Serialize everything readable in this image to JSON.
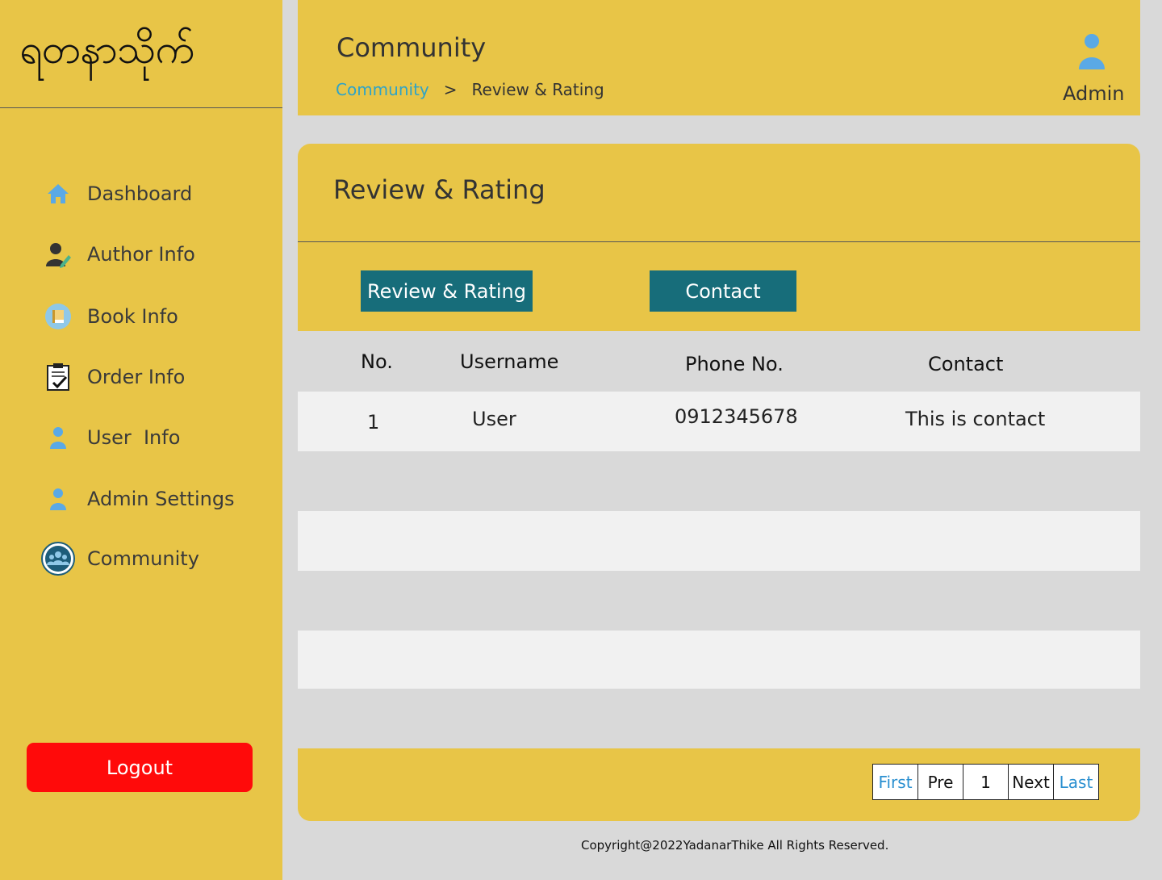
{
  "sidebar": {
    "logo": "ရတနာသိုက်",
    "items": [
      {
        "label": "Dashboard",
        "icon": "home-icon"
      },
      {
        "label": "Author Info",
        "icon": "author-icon"
      },
      {
        "label": "Book Info",
        "icon": "book-icon"
      },
      {
        "label": "Order Info",
        "icon": "clipboard-icon"
      },
      {
        "label": "User  Info",
        "icon": "user-icon"
      },
      {
        "label": "Admin Settings",
        "icon": "admin-icon"
      },
      {
        "label": "Community",
        "icon": "community-icon"
      }
    ],
    "logout_label": "Logout"
  },
  "header": {
    "title": "Community",
    "breadcrumb": {
      "parent": "Community",
      "separator": ">",
      "current": "Review & Rating"
    },
    "user_label": "Admin"
  },
  "card": {
    "title": "Review & Rating",
    "tabs": [
      "Review & Rating",
      "Contact"
    ]
  },
  "table": {
    "headers": {
      "no": "No.",
      "username": "Username",
      "phone": "Phone No.",
      "contact": "Contact"
    },
    "rows": [
      {
        "no": "1",
        "username": "User",
        "phone": "0912345678",
        "contact": "This is contact"
      }
    ]
  },
  "pagination": {
    "first": "First",
    "pre": "Pre",
    "current": "1",
    "next": "Next",
    "last": "Last"
  },
  "footer": {
    "copyright": "Copyright@2022YadanarThike All Rights Reserved."
  },
  "colors": {
    "panel": "#e8c547",
    "tab_button": "#176d7a",
    "logout": "#ff0a0a",
    "link": "#2ea3c7",
    "icon_blue": "#5aa9e6"
  }
}
